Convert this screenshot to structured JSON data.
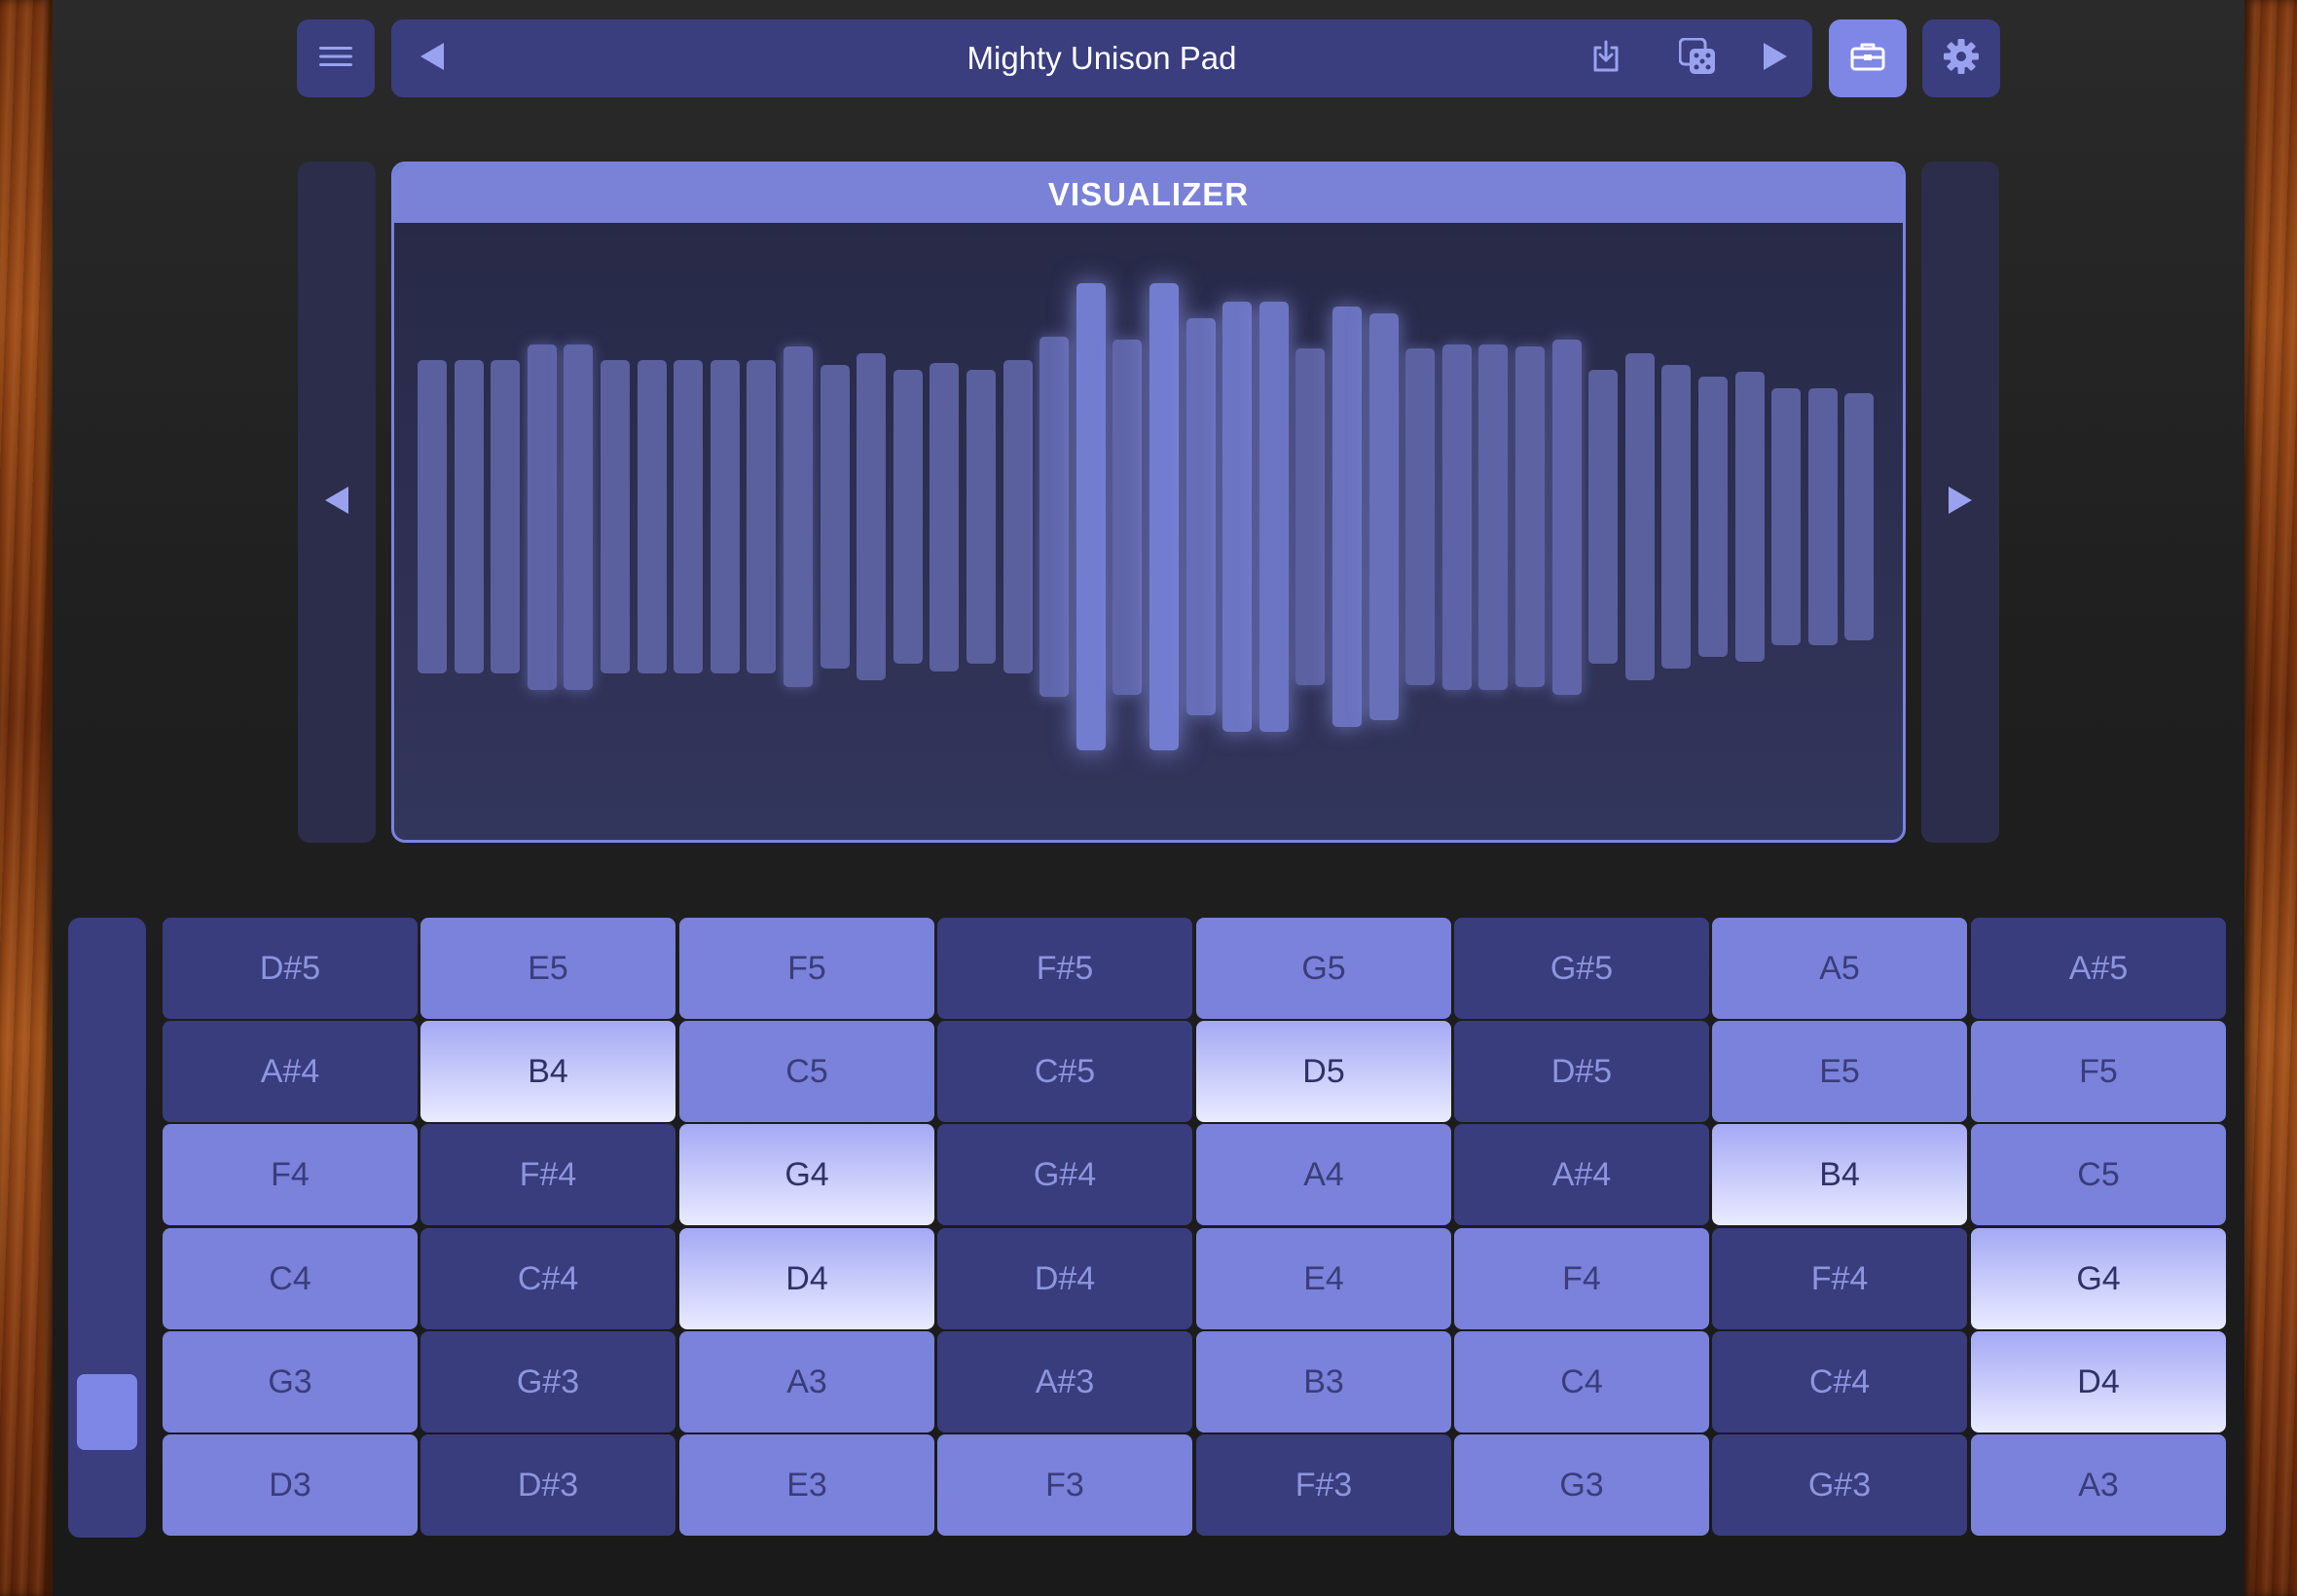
{
  "toolbar": {
    "preset_name": "Mighty Unison Pad",
    "icons": {
      "menu": "menu-icon",
      "prev": "prev-preset-icon",
      "save": "save-download-icon",
      "random": "dice-icon",
      "next": "next-preset-icon",
      "toolbox": "toolbox-icon",
      "settings": "gear-icon"
    }
  },
  "visualizer": {
    "title": "VISUALIZER",
    "bar_heights": [
      0.67,
      0.67,
      0.67,
      0.74,
      0.74,
      0.67,
      0.67,
      0.67,
      0.67,
      0.67,
      0.73,
      0.65,
      0.7,
      0.63,
      0.66,
      0.63,
      0.67,
      0.77,
      1.0,
      0.76,
      1.0,
      0.85,
      0.92,
      0.92,
      0.72,
      0.9,
      0.87,
      0.72,
      0.74,
      0.74,
      0.73,
      0.76,
      0.63,
      0.7,
      0.65,
      0.6,
      0.62,
      0.55,
      0.55,
      0.53
    ]
  },
  "pads": [
    [
      [
        "D#5",
        "dark"
      ],
      [
        "E5",
        "mid"
      ],
      [
        "F5",
        "mid"
      ],
      [
        "F#5",
        "dark"
      ],
      [
        "G5",
        "mid"
      ],
      [
        "G#5",
        "dark"
      ],
      [
        "A5",
        "mid"
      ],
      [
        "A#5",
        "dark"
      ]
    ],
    [
      [
        "A#4",
        "dark"
      ],
      [
        "B4",
        "light"
      ],
      [
        "C5",
        "mid"
      ],
      [
        "C#5",
        "dark"
      ],
      [
        "D5",
        "light"
      ],
      [
        "D#5",
        "dark"
      ],
      [
        "E5",
        "mid"
      ],
      [
        "F5",
        "mid"
      ]
    ],
    [
      [
        "F4",
        "mid"
      ],
      [
        "F#4",
        "dark"
      ],
      [
        "G4",
        "light"
      ],
      [
        "G#4",
        "dark"
      ],
      [
        "A4",
        "mid"
      ],
      [
        "A#4",
        "dark"
      ],
      [
        "B4",
        "light"
      ],
      [
        "C5",
        "mid"
      ]
    ],
    [
      [
        "C4",
        "mid"
      ],
      [
        "C#4",
        "dark"
      ],
      [
        "D4",
        "light"
      ],
      [
        "D#4",
        "dark"
      ],
      [
        "E4",
        "mid"
      ],
      [
        "F4",
        "mid"
      ],
      [
        "F#4",
        "dark"
      ],
      [
        "G4",
        "light"
      ]
    ],
    [
      [
        "G3",
        "mid"
      ],
      [
        "G#3",
        "dark"
      ],
      [
        "A3",
        "mid"
      ],
      [
        "A#3",
        "dark"
      ],
      [
        "B3",
        "mid"
      ],
      [
        "C4",
        "mid"
      ],
      [
        "C#4",
        "dark"
      ],
      [
        "D4",
        "light"
      ]
    ],
    [
      [
        "D3",
        "mid"
      ],
      [
        "D#3",
        "dark"
      ],
      [
        "E3",
        "mid"
      ],
      [
        "F3",
        "mid"
      ],
      [
        "F#3",
        "dark"
      ],
      [
        "G3",
        "mid"
      ],
      [
        "G#3",
        "dark"
      ],
      [
        "A3",
        "mid"
      ]
    ]
  ],
  "scroll_position": 0.85,
  "colors": {
    "accent": "#7e86e6",
    "dark_pad": "#393c7d",
    "mid_pad": "#7a82db",
    "light_pad": "#e9ebff"
  }
}
